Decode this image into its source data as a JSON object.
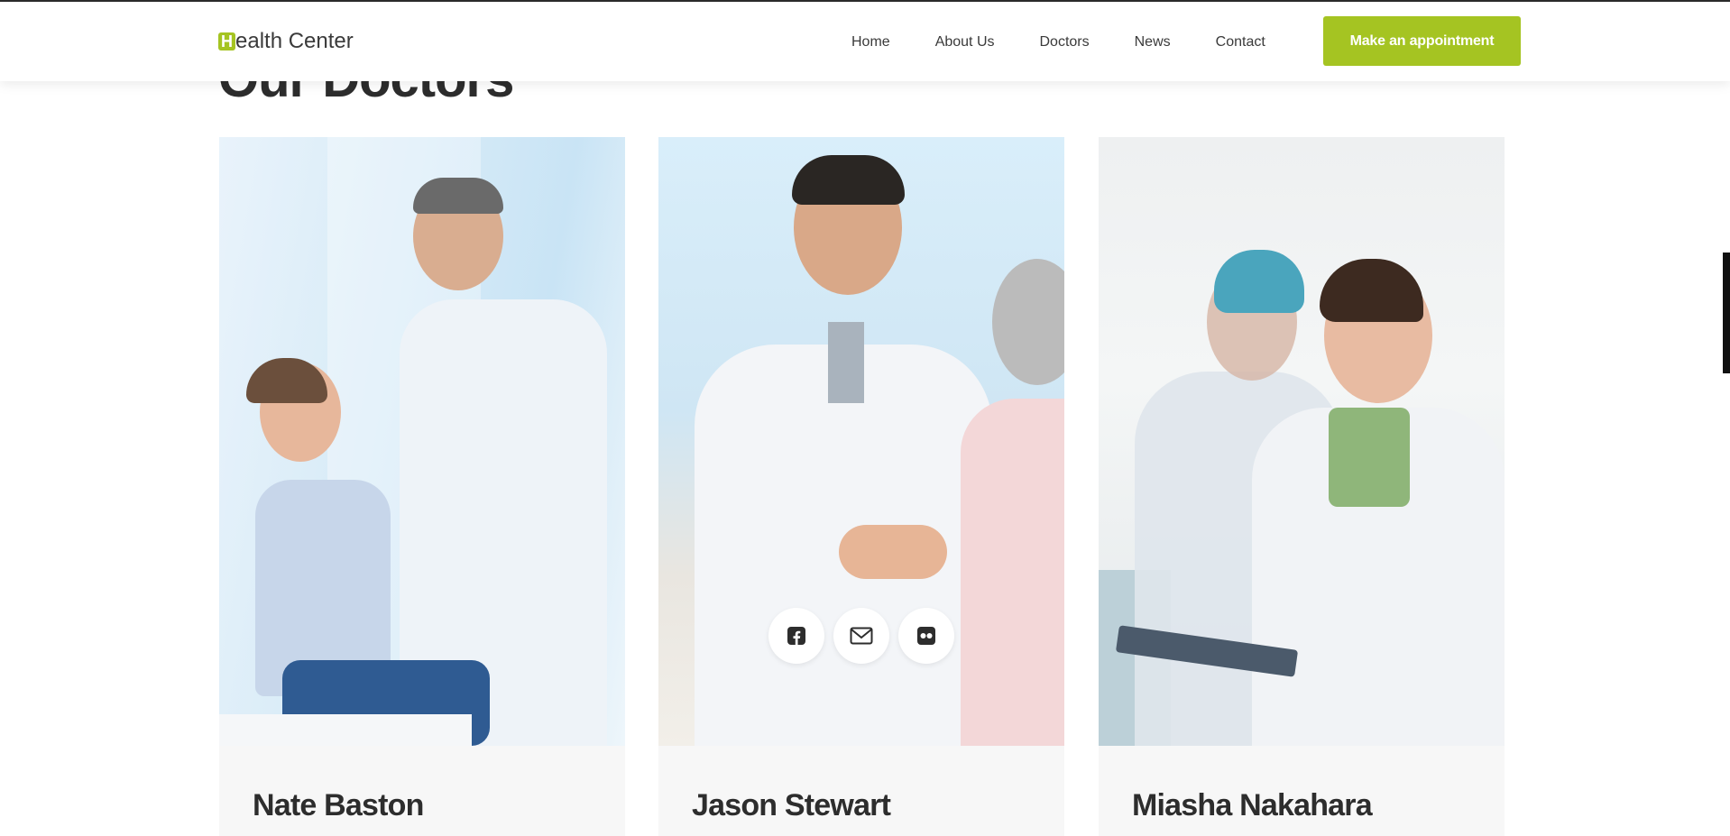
{
  "header": {
    "logo_mark": "H",
    "logo_text": "ealth Center",
    "nav": [
      "Home",
      "About Us",
      "Doctors",
      "News",
      "Contact"
    ],
    "cta_label": "Make an appointment"
  },
  "section_title": "Our Doctors",
  "doctors": [
    {
      "name": "Nate Baston"
    },
    {
      "name": "Jason Stewart"
    },
    {
      "name": "Miasha Nakahara"
    }
  ],
  "social_icons": [
    "facebook-icon",
    "envelope-icon",
    "flickr-icon"
  ],
  "colors": {
    "accent": "#a5c422",
    "text": "#2d2d2d"
  }
}
